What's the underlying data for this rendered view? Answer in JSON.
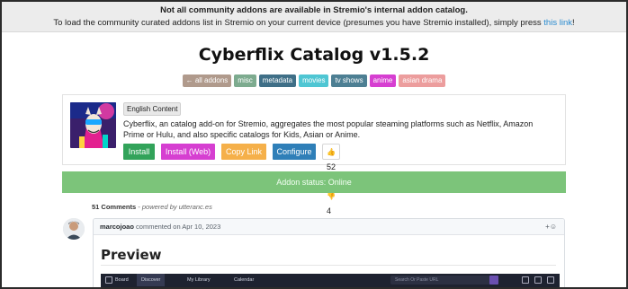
{
  "banner": {
    "line1": "Not all community addons are available in Stremio's internal addon catalog.",
    "line2_prefix": "To load the community curated addons list in Stremio on your current device (presumes you have Stremio installed), simply press ",
    "link": "this link",
    "line2_suffix": "!"
  },
  "title": "Cyberflix Catalog v1.5.2",
  "tags": [
    {
      "label": "← all addons",
      "color": "#b09a8c"
    },
    {
      "label": "misc",
      "color": "#7dab8f"
    },
    {
      "label": "metadata",
      "color": "#3f6f87"
    },
    {
      "label": "movies",
      "color": "#4fc6d3"
    },
    {
      "label": "tv shows",
      "color": "#4d7f93"
    },
    {
      "label": "anime",
      "color": "#d63fd1"
    },
    {
      "label": "asian drama",
      "color": "#ec9d9d"
    }
  ],
  "addon": {
    "language": "English Content",
    "description": "Cyberflix, an catalog add-on for Stremio, aggregates the most popular steaming platforms such as Netflix, Amazon Prime or Hulu, and also specific catalogs for Kids, Asian or Anime.",
    "buttons": {
      "install": "Install",
      "install_web": "Install (Web)",
      "copy_link": "Copy Link",
      "configure": "Configure"
    },
    "upvote_icon": "👍",
    "downvote_icon": "👎",
    "upvotes": "52",
    "downvotes": "4"
  },
  "status": "Addon status: Online",
  "comments": {
    "count_label": "51 Comments",
    "powered_by": " - powered by utteranc.es",
    "author": "marcojoao",
    "meta": " commented on Apr 10, 2023",
    "reaction_icon": "+☺",
    "heading": "Preview",
    "screenshot": {
      "nav": [
        "Board",
        "Discover",
        "My Library",
        "Calendar"
      ],
      "search_placeholder": "Search Or Paste URL"
    }
  },
  "colors": {
    "install": "#32a35a",
    "install_web": "#d63fd1",
    "copy_link": "#f5b04a",
    "configure": "#2f7fb8",
    "status_bg": "#7cc47a"
  }
}
